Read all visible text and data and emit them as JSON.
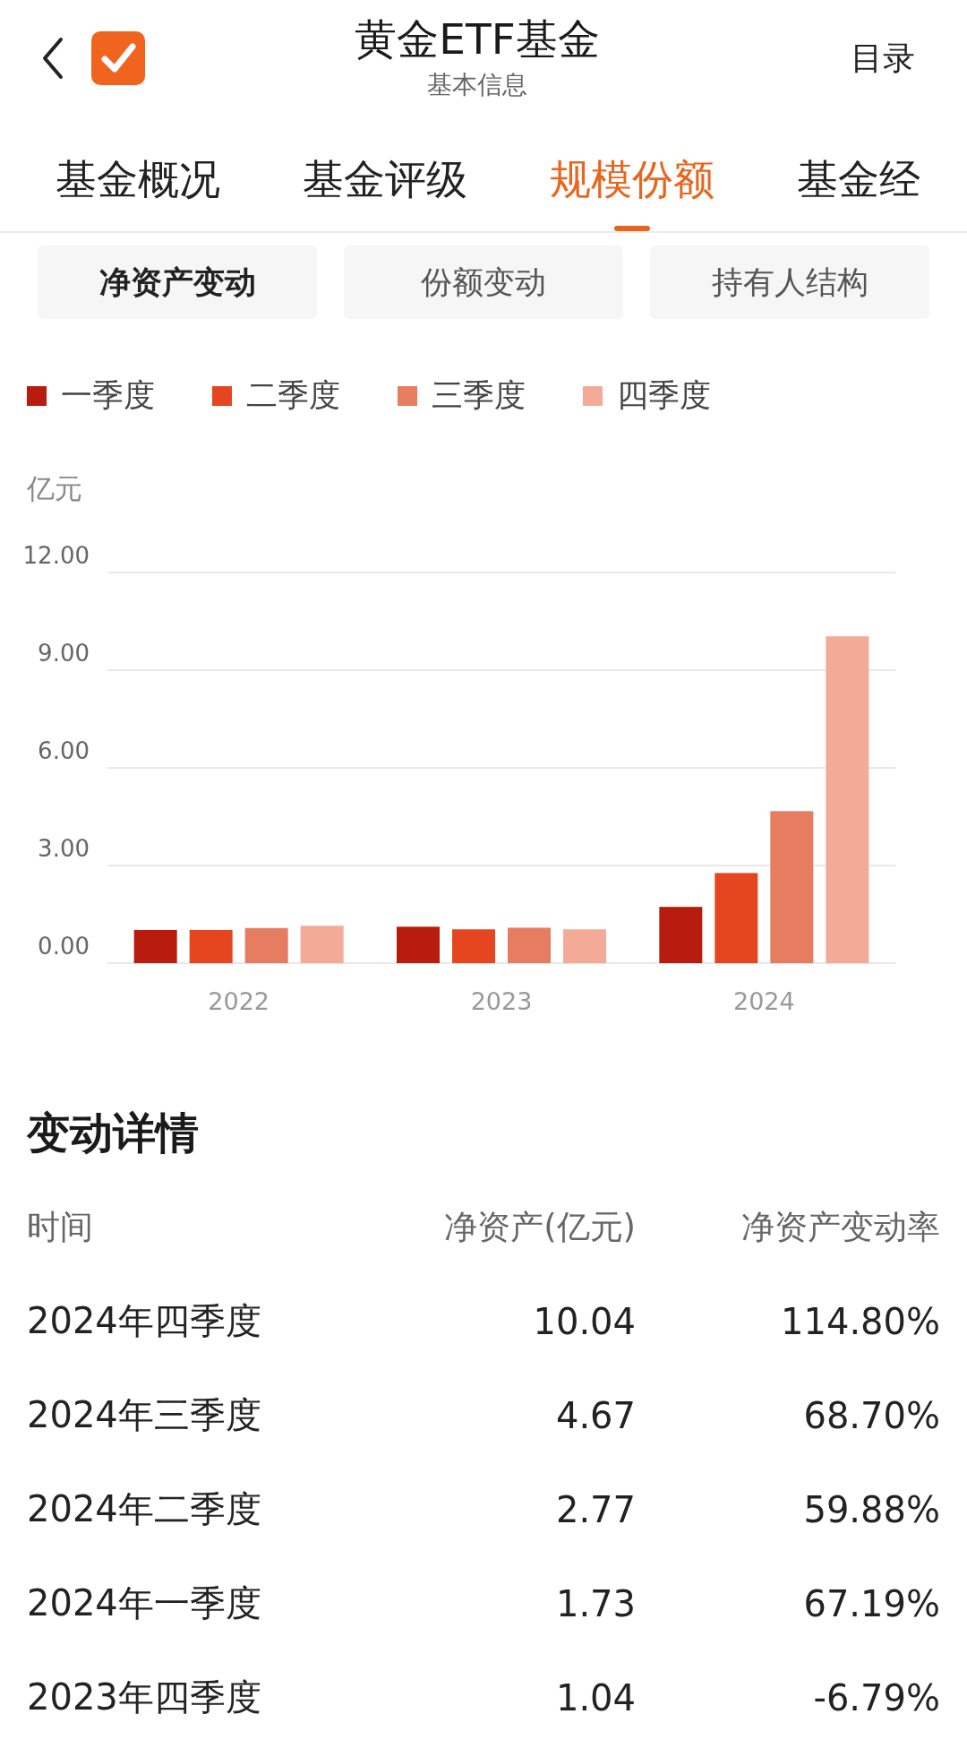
{
  "header": {
    "title": "黄金ETF基金",
    "subtitle": "基本信息",
    "menu": "目录"
  },
  "tabs": [
    {
      "label": "基金概况",
      "selected": false
    },
    {
      "label": "基金评级",
      "selected": false
    },
    {
      "label": "规模份额",
      "selected": true
    },
    {
      "label": "基金经",
      "selected": false
    }
  ],
  "subtabs": [
    {
      "label": "净资产变动",
      "selected": true
    },
    {
      "label": "份额变动",
      "selected": false
    },
    {
      "label": "持有人结构",
      "selected": false
    }
  ],
  "chart": {
    "unit": "亿元",
    "chart_data": {
      "type": "bar",
      "grid": true,
      "categories": [
        "2022",
        "2023",
        "2024"
      ],
      "ylim": [
        0,
        12
      ],
      "yticks": [
        {
          "value": 0,
          "label": "0.00"
        },
        {
          "value": 3,
          "label": "3.00"
        },
        {
          "value": 6,
          "label": "6.00"
        },
        {
          "value": 9,
          "label": "9.00"
        },
        {
          "value": 12,
          "label": "12.00"
        }
      ],
      "series": [
        {
          "name": "一季度",
          "color": "#b71c0f",
          "values": [
            1.02,
            1.12,
            1.73
          ]
        },
        {
          "name": "二季度",
          "color": "#e5451f",
          "values": [
            1.02,
            1.04,
            2.77
          ]
        },
        {
          "name": "三季度",
          "color": "#e77d60",
          "values": [
            1.08,
            1.09,
            4.67
          ]
        },
        {
          "name": "四季度",
          "color": "#f3ab98",
          "values": [
            1.15,
            1.04,
            10.04
          ]
        }
      ]
    }
  },
  "details": {
    "title": "变动详情",
    "columns": [
      "时间",
      "净资产(亿元)",
      "净资产变动率"
    ],
    "rows": [
      [
        "2024年四季度",
        "10.04",
        "114.80%"
      ],
      [
        "2024年三季度",
        "4.67",
        "68.70%"
      ],
      [
        "2024年二季度",
        "2.77",
        "59.88%"
      ],
      [
        "2024年一季度",
        "1.73",
        "67.19%"
      ],
      [
        "2023年四季度",
        "1.04",
        "-6.79%"
      ]
    ]
  }
}
